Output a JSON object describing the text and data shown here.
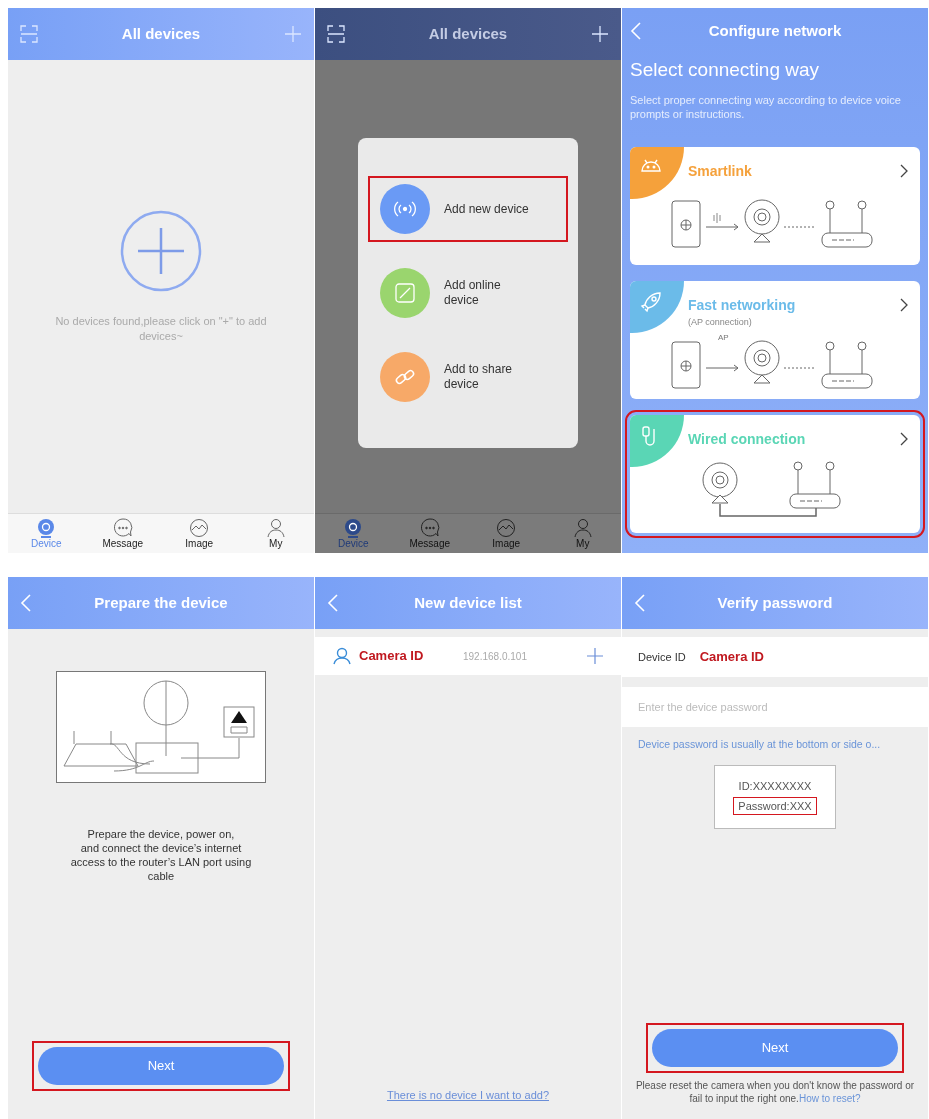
{
  "screens": [
    {
      "kind": "home",
      "title": "All devices",
      "dimmed": false,
      "empty_message": "No devices found,please click on \"+\" to add devices~",
      "tabs": [
        {
          "label": "Device",
          "selected": true
        },
        {
          "label": "Message",
          "selected": false
        },
        {
          "label": "Image",
          "selected": false
        },
        {
          "label": "My",
          "selected": false
        }
      ]
    },
    {
      "kind": "home",
      "title": "All devices",
      "dimmed": true,
      "tabs": [
        {
          "label": "Device",
          "selected": true
        },
        {
          "label": "Message",
          "selected": false
        },
        {
          "label": "Image",
          "selected": false
        },
        {
          "label": "My",
          "selected": false
        }
      ],
      "popup": {
        "items": [
          {
            "kind": "wireless",
            "label": "Add new device",
            "color": "#6a9af5",
            "highlighted": true
          },
          {
            "kind": "edit",
            "label": "Add online device",
            "color": "#9ad56e",
            "highlighted": false
          },
          {
            "kind": "link",
            "label": "Add to share device",
            "color": "#f7a968",
            "highlighted": false
          }
        ]
      }
    },
    {
      "kind": "configure",
      "title": "Configure network",
      "heading": "Select connecting way",
      "subtitle": "Select proper connecting way according to device voice prompts or instructions.",
      "options": [
        {
          "kind": "smartlink",
          "label": "Smartlink",
          "color": "#f5a13b",
          "highlighted": false
        },
        {
          "kind": "ap",
          "label": "Fast networking",
          "note": "(AP connection)",
          "diagram_label": "AP",
          "color": "#6bbbe9",
          "highlighted": false
        },
        {
          "kind": "wired",
          "label": "Wired connection",
          "color": "#5ad6b5",
          "highlighted": true
        }
      ]
    },
    {
      "kind": "prepare",
      "title": "Prepare the device",
      "instructions": "Prepare the device, power on,\nand connect the device’s internet\naccess to the router’s LAN port using\ncable",
      "button": {
        "label": "Next",
        "highlighted": true
      }
    },
    {
      "kind": "device_list",
      "title": "New device list",
      "devices": [
        {
          "name": "Camera ID",
          "ip": "192.168.0.101"
        }
      ],
      "help_link": "There is no device I want to add?"
    },
    {
      "kind": "verify",
      "title": "Verify password",
      "device_id_label": "Device ID",
      "device_id": "Camera ID",
      "password_placeholder": "Enter the device password",
      "hint": "Device password is usually at the bottom or side o...",
      "label_card": {
        "id_line": "ID:XXXXXXXX",
        "password_line": "Password:XXX"
      },
      "button": {
        "label": "Next",
        "highlighted": true
      },
      "footer": "Please reset the camera when you don't know the password or fail to input the right one.",
      "footer_link": "How to reset?"
    }
  ]
}
